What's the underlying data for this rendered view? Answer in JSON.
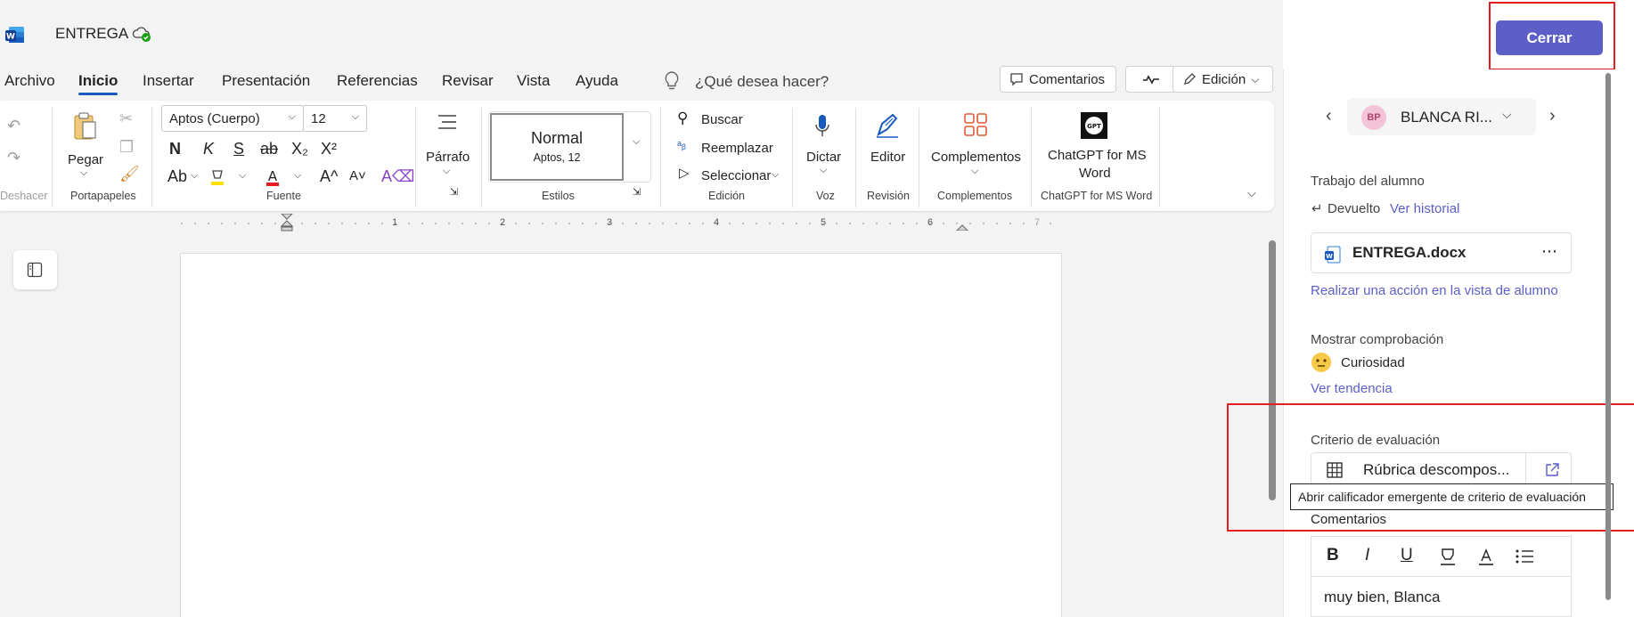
{
  "app": {
    "doc_title": "ENTREGA"
  },
  "menu": {
    "tabs": [
      "Archivo",
      "Inicio",
      "Insertar",
      "Presentación",
      "Referencias",
      "Revisar",
      "Vista",
      "Ayuda"
    ],
    "active_tab": "Inicio",
    "tell_me": "¿Qué desea hacer?",
    "comments_label": "Comentarios",
    "editing_label": "Edición"
  },
  "ribbon": {
    "undo_group": "Deshacer",
    "paste_label": "Pegar",
    "clipboard_group": "Portapapeles",
    "font_name": "Aptos (Cuerpo)",
    "font_size": "12",
    "font_group": "Fuente",
    "bold_glyph": "N",
    "italic_glyph": "K",
    "underline_glyph": "S",
    "strike_glyph": "ab",
    "sub_glyph": "X₂",
    "sup_glyph": "X²",
    "case_glyph": "Ab",
    "grow_glyph": "A^",
    "shrink_glyph": "A˅",
    "paragraph_label": "Párrafo",
    "style_name": "Normal",
    "style_sub": "Aptos, 12",
    "styles_group": "Estilos",
    "find_label": "Buscar",
    "replace_label": "Reemplazar",
    "select_label": "Seleccionar",
    "editing_group": "Edición",
    "dictate_label": "Dictar",
    "voice_group": "Voz",
    "editor_label": "Editor",
    "review_group": "Revisión",
    "addins_label": "Complementos",
    "addins_group": "Complementos",
    "chatgpt_label_1": "ChatGPT for MS",
    "chatgpt_label_2": "Word",
    "chatgpt_group": "ChatGPT for MS Word"
  },
  "ruler": {
    "numbers": [
      "1",
      "2",
      "3",
      "4",
      "5",
      "6",
      "7"
    ]
  },
  "panel": {
    "close_label": "Cerrar",
    "student_initials": "BP",
    "student_name": "BLANCA RI...",
    "student_work_heading": "Trabajo del alumno",
    "status_text": "Devuelto",
    "history_link": "Ver historial",
    "file_name": "ENTREGA.docx",
    "student_view_link": "Realizar una acción en la vista de alumno",
    "check_heading": "Mostrar comprobación",
    "check_value": "Curiosidad",
    "trend_link": "Ver tendencia",
    "rubric_heading": "Criterio de evaluación",
    "rubric_name": "Rúbrica descompos...",
    "tooltip": "Abrir calificador emergente de criterio de evaluación",
    "comments_heading": "Comentarios",
    "comment_text": "muy bien, Blanca"
  },
  "colors": {
    "accent": "#5b5fc7",
    "word_blue": "#185abd",
    "highlight_red": "#e41d23"
  }
}
